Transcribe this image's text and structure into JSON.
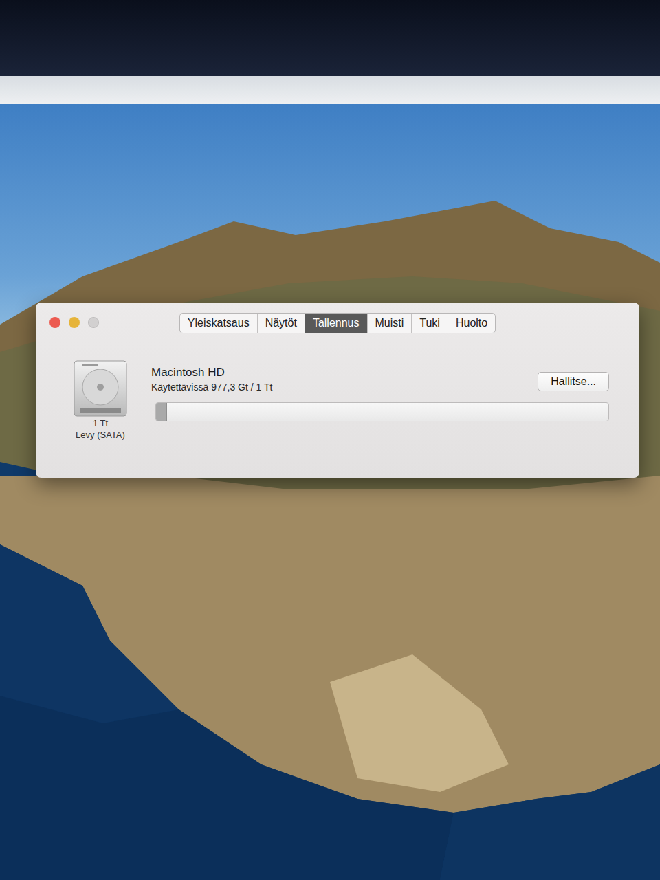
{
  "window": {
    "tabs": [
      {
        "label": "Yleiskatsaus",
        "selected": false
      },
      {
        "label": "Näytöt",
        "selected": false
      },
      {
        "label": "Tallennus",
        "selected": true
      },
      {
        "label": "Muisti",
        "selected": false
      },
      {
        "label": "Tuki",
        "selected": false
      },
      {
        "label": "Huolto",
        "selected": false
      }
    ]
  },
  "disk": {
    "name": "Macintosh HD",
    "available": "Käytettävissä 977,3 Gt / 1 Tt",
    "level": 0.023,
    "size": "1 Tt",
    "type": "Levy (SATA)",
    "button": "Hallitse..."
  }
}
